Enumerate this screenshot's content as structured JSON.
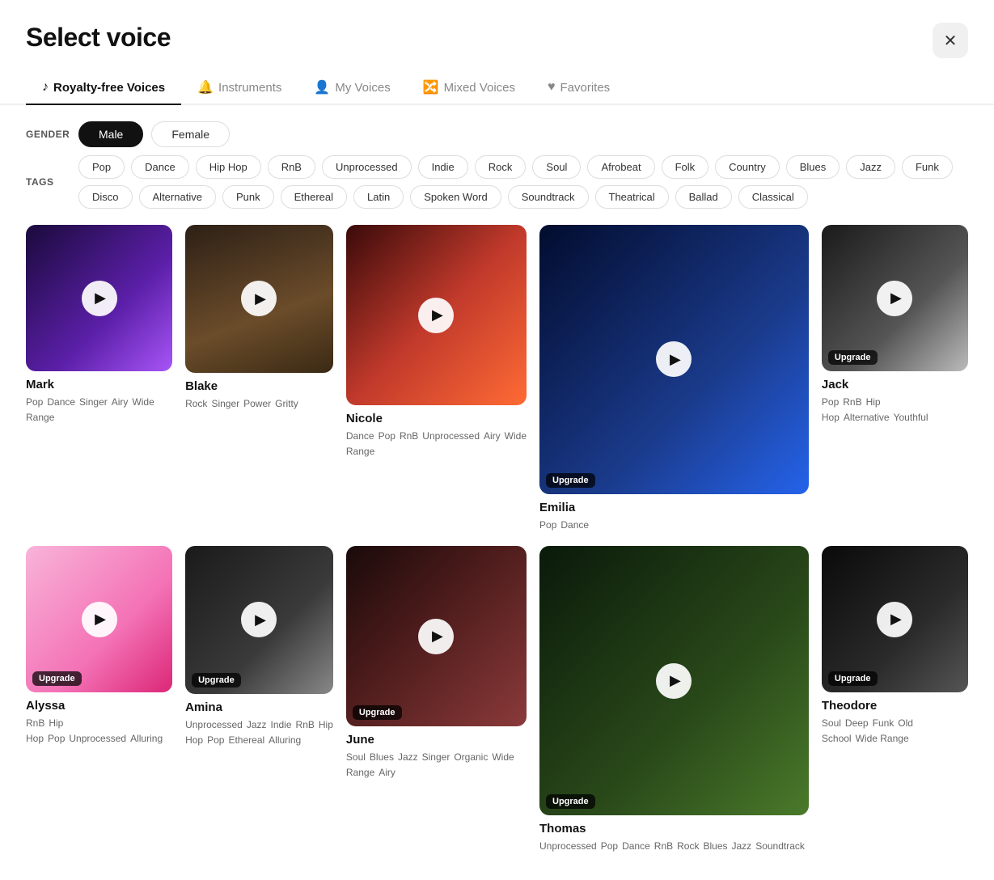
{
  "page": {
    "title": "Select voice",
    "close_label": "✕"
  },
  "tabs": [
    {
      "id": "royalty-free",
      "label": "Royalty-free Voices",
      "icon": "♪",
      "active": true
    },
    {
      "id": "instruments",
      "label": "Instruments",
      "icon": "🔔",
      "active": false
    },
    {
      "id": "my-voices",
      "label": "My Voices",
      "icon": "👤",
      "active": false
    },
    {
      "id": "mixed-voices",
      "label": "Mixed Voices",
      "icon": "🔀",
      "active": false
    },
    {
      "id": "favorites",
      "label": "Favorites",
      "icon": "♥",
      "active": false
    }
  ],
  "filters": {
    "gender_label": "GENDER",
    "tags_label": "TAGS",
    "gender_options": [
      {
        "label": "Male",
        "active": true
      },
      {
        "label": "Female",
        "active": false
      }
    ],
    "tag_options": [
      "Pop",
      "Dance",
      "Hip Hop",
      "RnB",
      "Unprocessed",
      "Indie",
      "Rock",
      "Soul",
      "Afrobeat",
      "Folk",
      "Country",
      "Blues",
      "Jazz",
      "Funk",
      "Disco",
      "Alternative",
      "Punk",
      "Ethereal",
      "Latin",
      "Spoken Word",
      "Soundtrack",
      "Theatrical",
      "Ballad",
      "Classical"
    ]
  },
  "voices": [
    {
      "id": "mark",
      "name": "Mark",
      "card_class": "card-mark",
      "upgrade": false,
      "tags_line1": [
        "Pop",
        "Dance",
        "Singer",
        "Airy"
      ],
      "tags_line2": [
        "Wide Range"
      ]
    },
    {
      "id": "blake",
      "name": "Blake",
      "card_class": "card-blake",
      "upgrade": false,
      "tags_line1": [
        "Rock",
        "Singer",
        "Power",
        "Gritty"
      ],
      "tags_line2": []
    },
    {
      "id": "nicole",
      "name": "Nicole",
      "card_class": "card-nicole",
      "upgrade": false,
      "tags_line1": [
        "Dance",
        "Pop",
        "RnB",
        "Unprocessed"
      ],
      "tags_line2": [
        "Airy",
        "Wide Range"
      ]
    },
    {
      "id": "emilia",
      "name": "Emilia",
      "card_class": "card-emilia",
      "upgrade": true,
      "upgrade_label": "Upgrade",
      "tags_line1": [
        "Pop",
        "Dance"
      ],
      "tags_line2": []
    },
    {
      "id": "jack",
      "name": "Jack",
      "card_class": "card-jack",
      "upgrade": true,
      "upgrade_label": "Upgrade",
      "tags_line1": [
        "Pop",
        "RnB",
        "Hip Hop",
        "Alternative"
      ],
      "tags_line2": [
        "Youthful"
      ]
    },
    {
      "id": "alyssa",
      "name": "Alyssa",
      "card_class": "card-alyssa",
      "upgrade": true,
      "upgrade_label": "Upgrade",
      "tags_line1": [
        "RnB",
        "Hip Hop",
        "Pop",
        "Unprocessed"
      ],
      "tags_line2": [
        "Alluring"
      ]
    },
    {
      "id": "amina",
      "name": "Amina",
      "card_class": "card-amina",
      "upgrade": true,
      "upgrade_label": "Upgrade",
      "tags_line1": [
        "Unprocessed",
        "Jazz",
        "Indie",
        "RnB"
      ],
      "tags_line2": [
        "Hip Hop",
        "Pop",
        "Ethereal",
        "Alluring"
      ]
    },
    {
      "id": "june",
      "name": "June",
      "card_class": "card-june",
      "upgrade": true,
      "upgrade_label": "Upgrade",
      "tags_line1": [
        "Soul",
        "Blues",
        "Jazz",
        "Singer",
        "Organic"
      ],
      "tags_line2": [
        "Wide Range",
        "Airy"
      ]
    },
    {
      "id": "thomas",
      "name": "Thomas",
      "card_class": "card-thomas",
      "upgrade": true,
      "upgrade_label": "Upgrade",
      "tags_line1": [
        "Unprocessed",
        "Pop",
        "Dance",
        "RnB"
      ],
      "tags_line2": [
        "Rock",
        "Blues",
        "Jazz",
        "Soundtrack"
      ]
    },
    {
      "id": "theodore",
      "name": "Theodore",
      "card_class": "card-theodore",
      "upgrade": true,
      "upgrade_label": "Upgrade",
      "tags_line1": [
        "Soul",
        "Deep",
        "Funk",
        "Old School"
      ],
      "tags_line2": [
        "Wide Range"
      ]
    }
  ]
}
